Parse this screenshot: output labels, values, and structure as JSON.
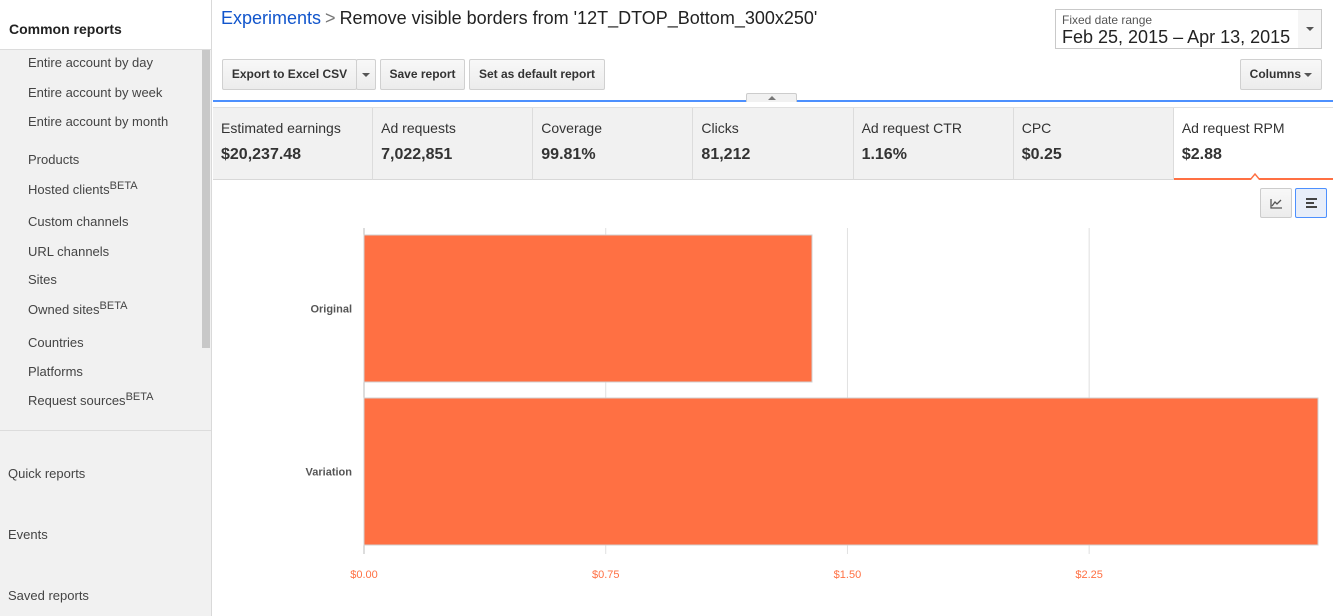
{
  "sidebar": {
    "section_title": "Common reports",
    "sub_items": [
      {
        "label": "Entire account by day",
        "badge": ""
      },
      {
        "label": "Entire account by week",
        "badge": ""
      },
      {
        "label": "Entire account by month",
        "badge": ""
      },
      {
        "label": "Products",
        "badge": ""
      },
      {
        "label": "Hosted clients",
        "badge": "BETA"
      },
      {
        "label": "Custom channels",
        "badge": ""
      },
      {
        "label": "URL channels",
        "badge": ""
      },
      {
        "label": "Sites",
        "badge": ""
      },
      {
        "label": "Owned sites",
        "badge": "BETA"
      },
      {
        "label": "Countries",
        "badge": ""
      },
      {
        "label": "Platforms",
        "badge": ""
      },
      {
        "label": "Request sources",
        "badge": "BETA"
      }
    ],
    "main_items": [
      "Quick reports",
      "Events",
      "Saved reports"
    ]
  },
  "header": {
    "breadcrumb_link": "Experiments",
    "breadcrumb_separator": ">",
    "title": "Remove visible borders from '12T_DTOP_Bottom_300x250'"
  },
  "date_range": {
    "label": "Fixed date range",
    "value": "Feb 25, 2015 – Apr 13, 2015"
  },
  "toolbar": {
    "export_label": "Export to Excel CSV",
    "save_label": "Save report",
    "default_label": "Set as default report",
    "columns_label": "Columns"
  },
  "metrics": [
    {
      "label": "Estimated earnings",
      "value": "$20,237.48",
      "active": false
    },
    {
      "label": "Ad requests",
      "value": "7,022,851",
      "active": false
    },
    {
      "label": "Coverage",
      "value": "99.81%",
      "active": false
    },
    {
      "label": "Clicks",
      "value": "81,212",
      "active": false
    },
    {
      "label": "Ad request CTR",
      "value": "1.16%",
      "active": false
    },
    {
      "label": "CPC",
      "value": "$0.25",
      "active": false
    },
    {
      "label": "Ad request RPM",
      "value": "$2.88",
      "active": true
    }
  ],
  "colors": {
    "accent": "#ff7043",
    "link": "#1155cc",
    "active_border": "#4d90fe"
  },
  "chart_data": {
    "type": "bar",
    "orientation": "horizontal",
    "categories": [
      "Original",
      "Variation"
    ],
    "values": [
      1.39,
      2.96
    ],
    "xlim": [
      0,
      2.96
    ],
    "x_ticks": [
      {
        "value": 0,
        "label": "$0.00"
      },
      {
        "value": 0.75,
        "label": "$0.75"
      },
      {
        "value": 1.5,
        "label": "$1.50"
      },
      {
        "value": 2.25,
        "label": "$2.25"
      }
    ],
    "grid": true,
    "bar_color": "#ff7043",
    "tick_label_color": "#ff7043"
  }
}
